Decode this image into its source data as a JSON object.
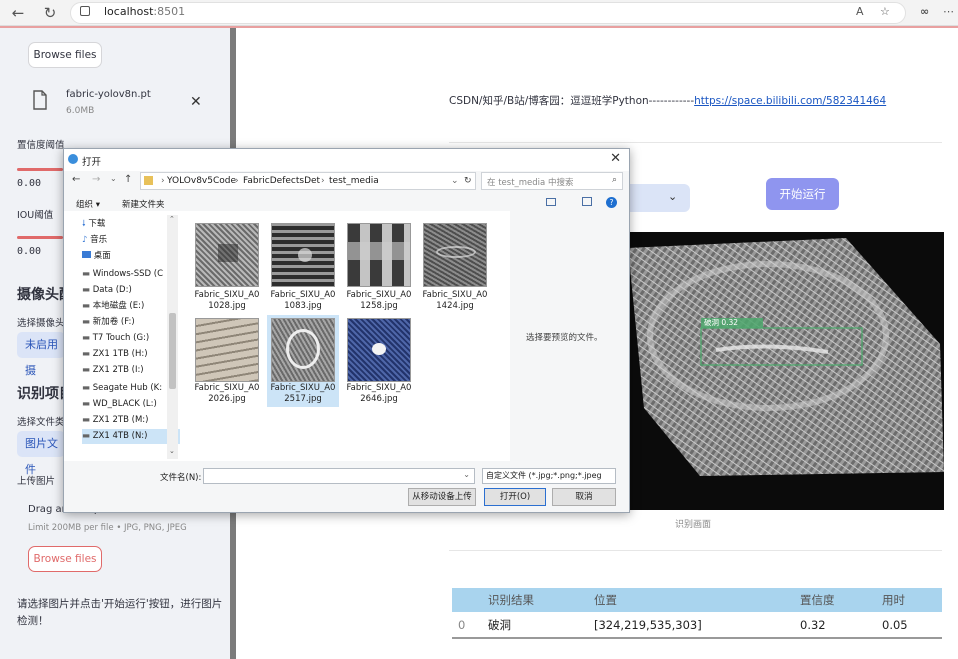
{
  "browser": {
    "url_host": "localhost",
    "url_port": ":8501"
  },
  "sidebar": {
    "browse_files_label": "Browse files",
    "model_file": {
      "name": "fabric-yolov8n.pt",
      "size": "6.0MB"
    },
    "confidence": {
      "label": "置信度阈值",
      "value": "0.00"
    },
    "iou": {
      "label": "IOU阈值",
      "value": "0.00"
    },
    "camera_section": {
      "heading": "摄像头配",
      "select_label": "选择摄像头",
      "select_value": "未启用摄"
    },
    "detect_section": {
      "heading": "识别项目",
      "select_label": "选择文件类",
      "select_value": "图片文件"
    },
    "upload": {
      "label": "上传图片",
      "drag_text": "Drag and drop files here",
      "limit_text": "Limit 200MB per file • JPG, PNG, JPEG",
      "browse_label": "Browse files"
    },
    "hint": "请选择图片并点击'开始运行'按钮，进行图片检测！"
  },
  "main": {
    "credit_text": "CSDN/知乎/B站/博客园：逗逗班学Python------------",
    "credit_link": "https://space.bilibili.com/582341464",
    "run_button": "开始运行",
    "image_caption": "识别画面",
    "detection_label": "破洞  0.32",
    "results": {
      "headers": [
        "",
        "识别结果",
        "位置",
        "置信度",
        "用时"
      ],
      "rows": [
        [
          "0",
          "破洞",
          "[324,219,535,303]",
          "0.32",
          "0.05"
        ]
      ]
    }
  },
  "dialog": {
    "title": "打开",
    "breadcrumb": [
      "YOLOv8v5Code",
      "FabricDefectsDet",
      "test_media"
    ],
    "search_placeholder": "在 test_media 中搜索",
    "organize": "组织 ▾",
    "new_folder": "新建文件夹",
    "tree": [
      "下载",
      "音乐",
      "桌面",
      "Windows-SSD (C",
      "Data (D:)",
      "本地磁盘 (E:)",
      "新加卷 (F:)",
      "T7 Touch (G:)",
      "ZX1 1TB (H:)",
      "ZX1 2TB (I:)",
      "Seagate Hub (K:",
      "WD_BLACK (L:)",
      "ZX1 2TB (M:)",
      "ZX1 4TB (N:)"
    ],
    "files": [
      {
        "name": "Fabric_SIXU_A01028.jpg",
        "line1": "Fabric_SIXU_A0",
        "line2": "1028.jpg"
      },
      {
        "name": "Fabric_SIXU_A01083.jpg",
        "line1": "Fabric_SIXU_A0",
        "line2": "1083.jpg"
      },
      {
        "name": "Fabric_SIXU_A01258.jpg",
        "line1": "Fabric_SIXU_A0",
        "line2": "1258.jpg"
      },
      {
        "name": "Fabric_SIXU_A01424.jpg",
        "line1": "Fabric_SIXU_A0",
        "line2": "1424.jpg"
      },
      {
        "name": "Fabric_SIXU_A02026.jpg",
        "line1": "Fabric_SIXU_A0",
        "line2": "2026.jpg"
      },
      {
        "name": "Fabric_SIXU_A02517.jpg",
        "line1": "Fabric_SIXU_A0",
        "line2": "2517.jpg"
      },
      {
        "name": "Fabric_SIXU_A02646.jpg",
        "line1": "Fabric_SIXU_A0",
        "line2": "2646.jpg"
      }
    ],
    "preview_text": "选择要预览的文件。",
    "filename_label": "文件名(N):",
    "filetype_value": "自定义文件 (*.jpg;*.png;*.jpeg",
    "mobile_button": "从移动设备上传",
    "open_button": "打开(O)",
    "cancel_button": "取消"
  },
  "colors": {
    "accent": "#8f95ef",
    "slider": "#e06a6a",
    "link": "#1a56c2",
    "table_header": "#a9d4ee"
  }
}
